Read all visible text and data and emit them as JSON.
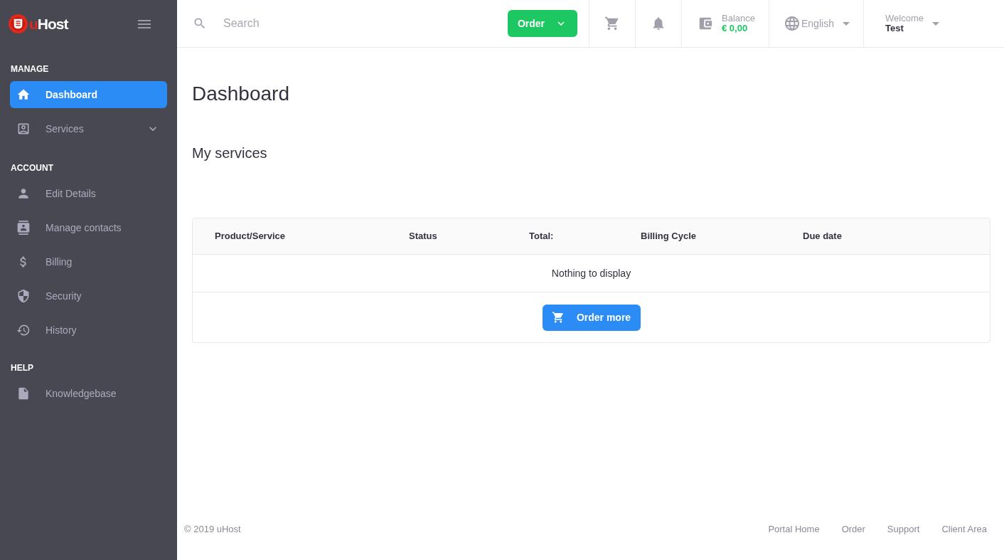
{
  "logo": {
    "accent": "u",
    "name": "Host"
  },
  "sidebar": {
    "sections": [
      {
        "title": "MANAGE",
        "items": [
          {
            "label": "Dashboard",
            "kind": "link",
            "selected": true
          },
          {
            "label": "Services",
            "kind": "menu",
            "selected": false,
            "expanded": false
          }
        ]
      },
      {
        "title": "ACCOUNT",
        "items": [
          {
            "label": "Edit Details",
            "kind": "link",
            "selected": false
          },
          {
            "label": "Manage contacts",
            "kind": "link",
            "selected": false
          },
          {
            "label": "Billing",
            "kind": "link",
            "selected": false
          },
          {
            "label": "Security",
            "kind": "link",
            "selected": false
          },
          {
            "label": "History",
            "kind": "link",
            "selected": false
          }
        ]
      },
      {
        "title": "HELP",
        "items": [
          {
            "label": "Knowledgebase",
            "kind": "link",
            "selected": false
          }
        ]
      }
    ]
  },
  "topbar": {
    "search": {
      "placeholder": "Search"
    },
    "order_button": "Order",
    "balance": {
      "label": "Balance",
      "amount": "€ 0,00"
    },
    "language": "English",
    "user": {
      "greeting": "Welcome",
      "name": "Test"
    }
  },
  "main": {
    "title": "Dashboard",
    "section_title": "My services",
    "table": {
      "columns": [
        "Product/Service",
        "Status",
        "Total:",
        "Billing Cycle",
        "Due date"
      ],
      "empty_message": "Nothing to display",
      "order_more": "Order more"
    }
  },
  "footer": {
    "copyright": "© 2019 uHost",
    "links": [
      "Portal Home",
      "Order",
      "Support",
      "Client Area"
    ]
  }
}
